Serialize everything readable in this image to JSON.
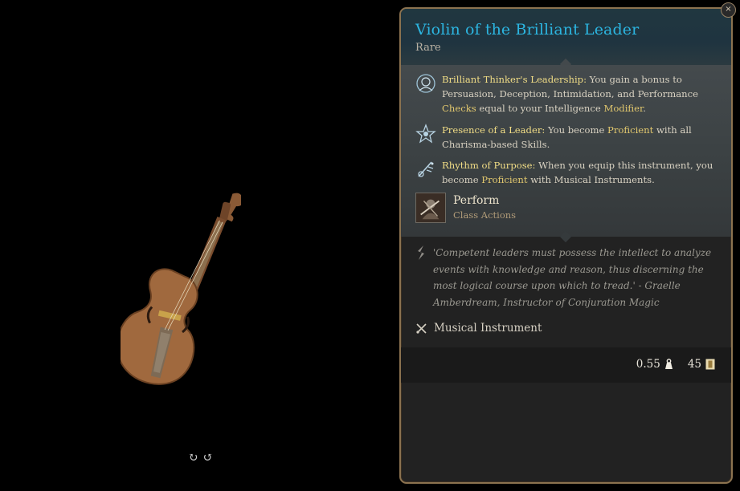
{
  "preview": {
    "rotate_left": "↻",
    "rotate_right": "↺"
  },
  "item": {
    "title": "Violin of the Brilliant Leader",
    "rarity": "Rare",
    "colors": {
      "title": "#2cb5e0",
      "passive_name": "#f1dd86",
      "keyword": "#e2c86e",
      "border": "#8c7350"
    }
  },
  "passives": [
    {
      "icon": "brilliant-thinker-icon",
      "name": "Brilliant Thinker's Leadership:",
      "t1": " You gain a bonus to Persuasion, Deception, Intimidation, and Performance ",
      "k1": "Checks",
      "t2": " equal to your Intelligence ",
      "k2": "Modifier",
      "t3": "."
    },
    {
      "icon": "presence-of-leader-icon",
      "name": "Presence of a Leader:",
      "t1": " You become ",
      "k1": "Proficient",
      "t2": " with all Charisma-based Skills."
    },
    {
      "icon": "rhythm-of-purpose-icon",
      "name": "Rhythm of Purpose:",
      "t1": " When you equip this instrument, you become ",
      "k1": "Proficient",
      "t2": " with Musical Instruments."
    }
  ],
  "action": {
    "name": "Perform",
    "subtitle": "Class Actions",
    "icon": "perform-action-icon"
  },
  "quote": "'Competent leaders must possess the intellect to analyze events with knowledge and reason, thus discerning the most logical course upon which to tread.' - Graelle Amberdream, Instructor of Conjuration Magic",
  "category": {
    "label": "Musical Instrument",
    "icon": "instrument-icon"
  },
  "stats": {
    "weight": "0.55",
    "weight_icon": "weight-icon",
    "value": "45",
    "value_icon": "gold-value-icon"
  },
  "close_label": "×"
}
